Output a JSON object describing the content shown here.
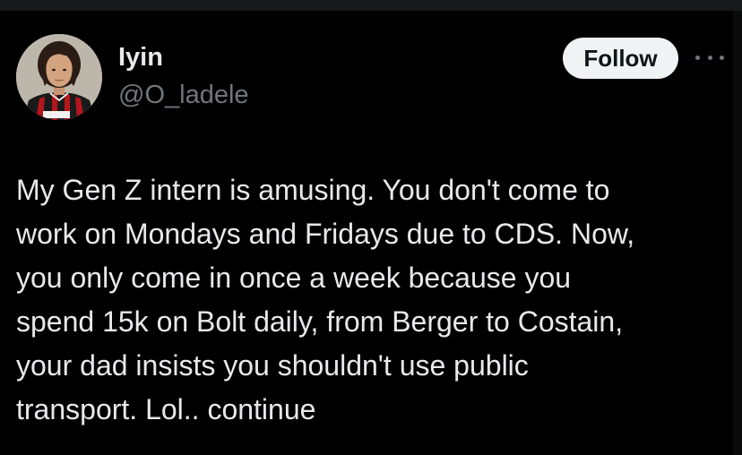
{
  "author": {
    "display_name": "Iyin",
    "handle": "@O_ladele"
  },
  "actions": {
    "follow_label": "Follow",
    "more_icon": "more-horizontal-icon"
  },
  "tweet": {
    "lines": [
      "My Gen Z intern is amusing. You don't come to",
      "work on Mondays and Fridays due to CDS. Now,",
      "you only come in once a week because you",
      "spend 15k on Bolt daily, from Berger to Costain,",
      "your dad insists you shouldn't use public",
      "transport. Lol.. continue"
    ]
  },
  "colors": {
    "background": "#000000",
    "primary_text": "#e7e9ea",
    "secondary_text": "#71767b",
    "follow_button_bg": "#eff3f4",
    "follow_button_text": "#0f1419"
  }
}
